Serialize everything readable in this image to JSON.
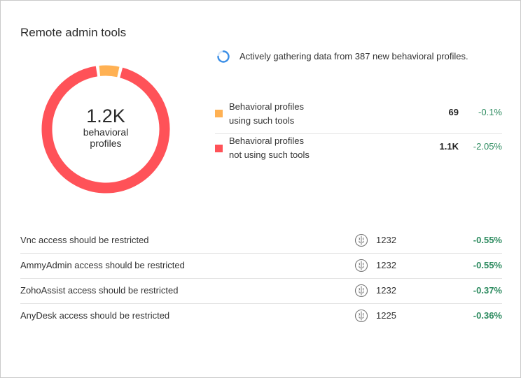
{
  "widget": {
    "title": "Remote admin tools"
  },
  "donut": {
    "center_value": "1.2K",
    "center_label_line1": "behavioral",
    "center_label_line2": "profiles",
    "segments": [
      {
        "name": "using",
        "value": 69,
        "color": "#ffb153"
      },
      {
        "name": "not_using",
        "value": 1100,
        "color": "#ff5258"
      }
    ]
  },
  "status": {
    "icon": "loading-spinner-icon",
    "text": "Actively gathering data from 387 new behavioral profiles."
  },
  "legend": [
    {
      "line1": "Behavioral profiles",
      "line2": "using such tools",
      "count": "69",
      "delta": "-0.1%",
      "color": "#ffb153"
    },
    {
      "line1": "Behavioral profiles",
      "line2": "not using such tools",
      "count": "1.1K",
      "delta": "-2.05%",
      "color": "#ff5258"
    }
  ],
  "rules": [
    {
      "label": "Vnc access should be restricted",
      "icon": "brain-icon",
      "count": "1232",
      "delta": "-0.55%"
    },
    {
      "label": "AmmyAdmin access should be restricted",
      "icon": "brain-icon",
      "count": "1232",
      "delta": "-0.55%"
    },
    {
      "label": "ZohoAssist access should be restricted",
      "icon": "brain-icon",
      "count": "1232",
      "delta": "-0.37%"
    },
    {
      "label": "AnyDesk access should be restricted",
      "icon": "brain-icon",
      "count": "1225",
      "delta": "-0.36%"
    }
  ],
  "colors": {
    "positive_delta": "#2b8a5e",
    "spinner": "#3a8ee6"
  }
}
